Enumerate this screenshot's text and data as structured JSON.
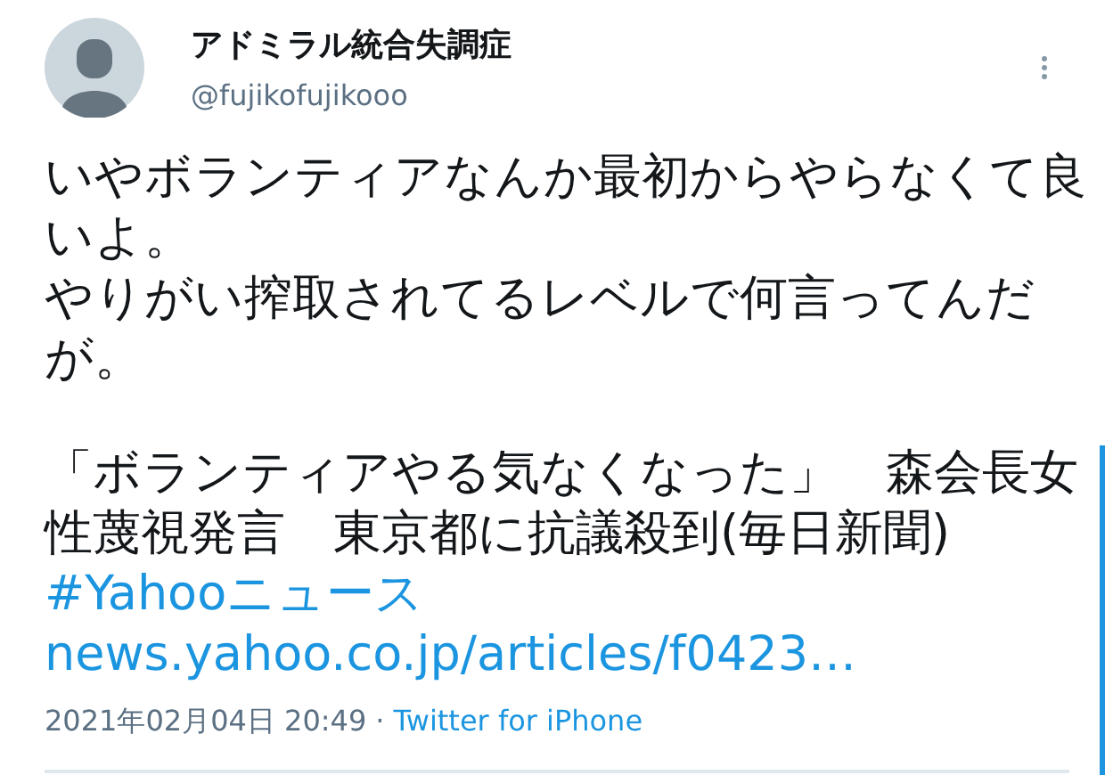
{
  "author": {
    "name": "アドミラル統合失調症",
    "handle": "@fujikofujikooo"
  },
  "paragraphs": [
    [
      {
        "kind": "text",
        "text": "いやボランティアなんか最初からやらなくて良いよ。"
      },
      {
        "kind": "text",
        "text": "やりがい搾取されてるレベルで何言ってんだが。"
      }
    ],
    [
      {
        "kind": "text",
        "text": "「ボランティアやる気なくなった」　森会長女性蔑視発言　東京都に抗議殺到(毎日新聞)"
      },
      {
        "kind": "hashtag",
        "text": "#Yahooニュース"
      },
      {
        "kind": "link",
        "text": "news.yahoo.co.jp/articles/f0423…"
      }
    ]
  ],
  "footer": {
    "timestamp": "2021年02月04日 20:49",
    "separator": "·",
    "source": "Twitter for iPhone"
  }
}
